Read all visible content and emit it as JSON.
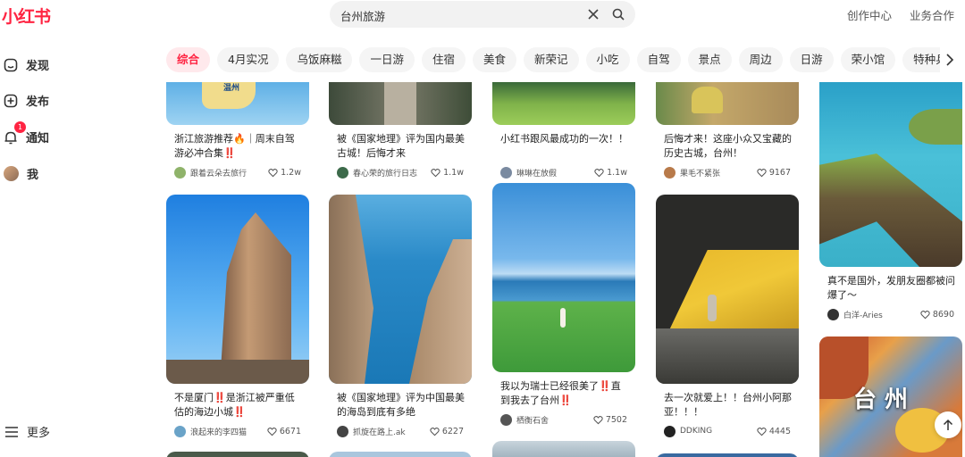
{
  "logo": "小红书",
  "search": {
    "query": "台州旅游"
  },
  "header_links": [
    "创作中心",
    "业务合作"
  ],
  "sidebar": {
    "items": [
      {
        "label": "发现",
        "icon": "discover-icon"
      },
      {
        "label": "发布",
        "icon": "plus-square-icon"
      },
      {
        "label": "通知",
        "icon": "bell-icon",
        "badge": "1"
      },
      {
        "label": "我",
        "icon": "avatar"
      }
    ],
    "more_label": "更多"
  },
  "tabs": [
    "综合",
    "4月实况",
    "乌饭麻糍",
    "一日游",
    "住宿",
    "美食",
    "新荣记",
    "小吃",
    "自驾",
    "景点",
    "周边",
    "日游",
    "荣小馆",
    "特种兵"
  ],
  "active_tab": "综合",
  "cards": [
    {
      "title": "浙江旅游推荐🔥｜周末自驾游必冲合集‼️",
      "author": "跟着云朵去旅行",
      "likes": "1.2w"
    },
    {
      "title": "被《国家地理》评为国内最美古城！后悔才来",
      "author": "春心荣的旅行日志",
      "likes": "1.1w"
    },
    {
      "title": "小红书跟风最成功的一次！！",
      "author": "琳琳在放假",
      "likes": "1.1w"
    },
    {
      "title": "后悔才来！这座小众又宝藏的历史古城，台州！",
      "author": "果毛不紧张",
      "likes": "9167"
    },
    {
      "title": "真不是国外，发朋友圈都被问爆了～",
      "author": "白洋-Aries",
      "likes": "8690"
    },
    {
      "title": "不是厦门‼️是浙江被严重低估的海边小城‼️",
      "author": "浪起来的李四猫",
      "likes": "6671"
    },
    {
      "title": "被《国家地理》评为中国最美的海岛到底有多绝",
      "author": "抓旋在路上.ak",
      "likes": "6227"
    },
    {
      "title": "我以为瑞士已经很美了‼️直到我去了台州‼️",
      "author": "栖衡石舍",
      "likes": "7502"
    },
    {
      "title": "去一次就爱上！！台州小阿那亚！！！",
      "author": "DDKING",
      "likes": "4445"
    }
  ],
  "thumb_text": {
    "card0": "温州",
    "card9": "台 州"
  },
  "colors": {
    "brand": "#ff2442",
    "tab_active_bg": "#ffe9ec"
  }
}
